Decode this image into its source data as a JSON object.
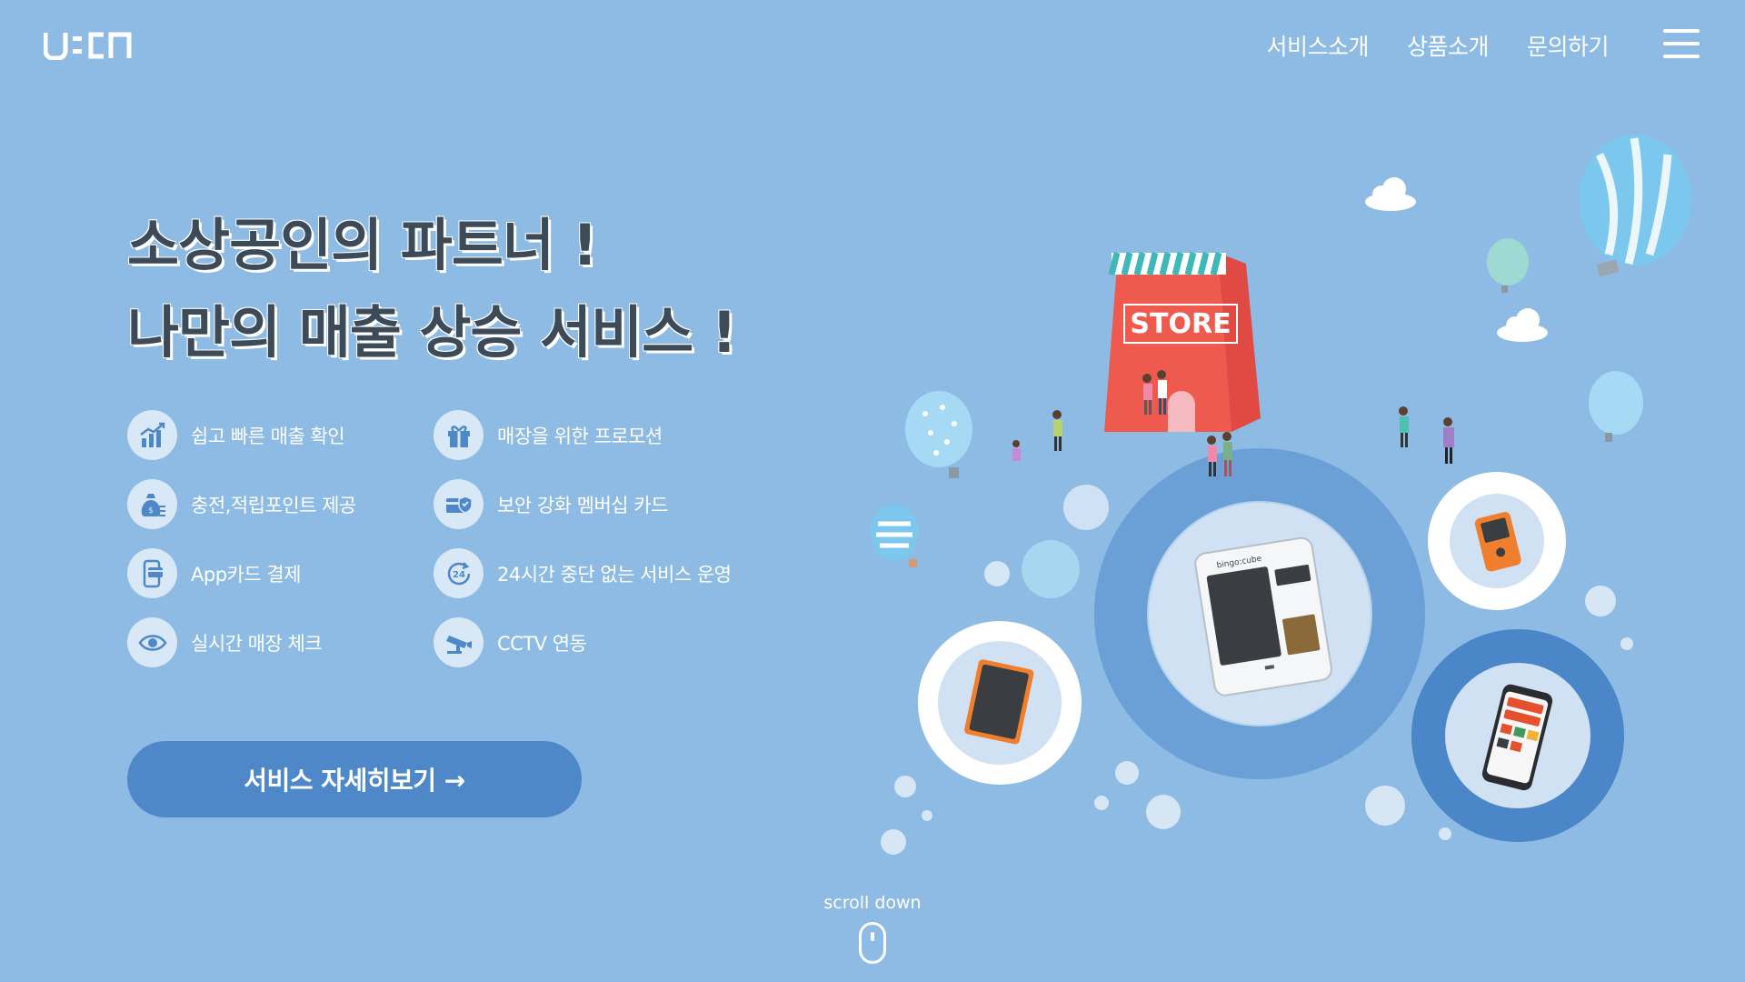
{
  "brand": {
    "logo_text": "UBCN"
  },
  "nav": {
    "items": [
      "서비스소개",
      "상품소개",
      "문의하기"
    ]
  },
  "hero": {
    "line1": "소상공인의 파트너 !",
    "line2": "나만의 매출 상승 서비스 !"
  },
  "features": [
    {
      "label": "쉽고 빠른 매출 확인",
      "icon": "chart-icon"
    },
    {
      "label": "매장을 위한 프로모션",
      "icon": "gift-icon"
    },
    {
      "label": "충전,적립포인트 제공",
      "icon": "money-bag-icon"
    },
    {
      "label": "보안 강화 멤버십 카드",
      "icon": "secure-card-icon"
    },
    {
      "label": "App카드 결제",
      "icon": "app-card-icon"
    },
    {
      "label": "24시간 중단 없는 서비스 운영",
      "icon": "24h-icon"
    },
    {
      "label": "실시간 매장 체크",
      "icon": "eye-icon"
    },
    {
      "label": "CCTV 연동",
      "icon": "cctv-icon"
    }
  ],
  "cta": {
    "label": "서비스 자세히보기 →"
  },
  "scroll": {
    "label": "scroll down"
  },
  "illustration": {
    "store_sign": "STORE",
    "kiosk_brand": "bingo:cube"
  },
  "colors": {
    "background": "#8dbbe4",
    "accent": "#4e88c8",
    "headline": "#3d4a57",
    "store": "#ef5a4f"
  }
}
